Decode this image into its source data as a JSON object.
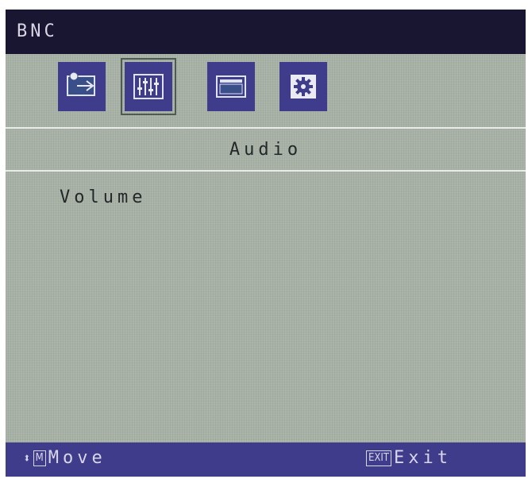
{
  "window": {
    "title": "BNC"
  },
  "icons": [
    {
      "name": "input-source-icon",
      "selected": false
    },
    {
      "name": "audio-equalizer-icon",
      "selected": true
    },
    {
      "name": "display-picture-icon",
      "selected": false
    },
    {
      "name": "settings-gear-icon",
      "selected": false
    }
  ],
  "section": {
    "title": "Audio"
  },
  "menu": {
    "items": [
      {
        "label": "Volume"
      }
    ]
  },
  "footer": {
    "move_arrow": "⬍",
    "move_key": "M",
    "move_label": "Move",
    "exit_key": "EXIT",
    "exit_label": "Exit"
  },
  "colors": {
    "title_bar": "#191631",
    "icon_tile": "#3e3c8b",
    "footer_bar": "#403c8c",
    "menu_background": "#a8b1a6"
  }
}
